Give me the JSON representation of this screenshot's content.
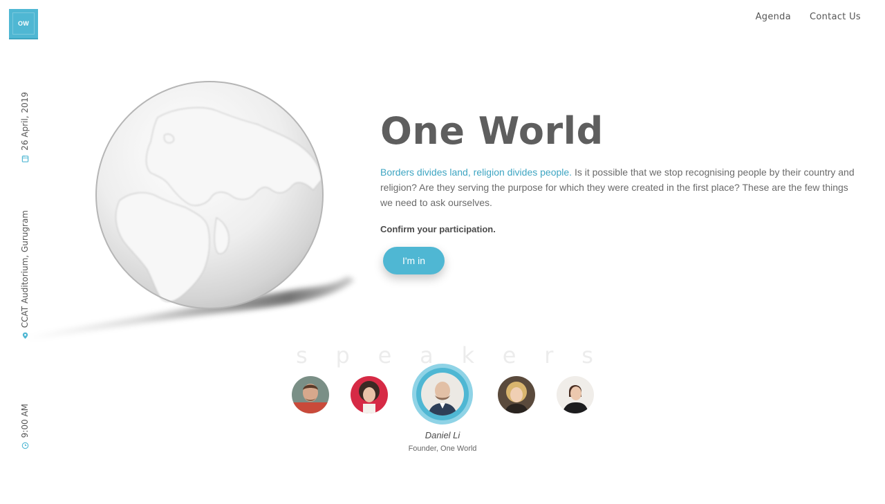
{
  "brand": {
    "logo_text": "OW",
    "accent_color": "#4fb7d3"
  },
  "nav": {
    "items": [
      "Agenda",
      "Contact Us"
    ]
  },
  "event": {
    "date": "26 April, 2019",
    "venue": "CCAT Auditorium, Gurugram",
    "time": "9:00 AM",
    "date_icon": "calendar-icon",
    "venue_icon": "location-pin-icon",
    "time_icon": "clock-icon"
  },
  "hero": {
    "title": "One World",
    "highlight": "Borders divides land, religion divides people.",
    "description": " Is it possible that we stop recognising people by their country and religion? Are they serving the purpose for which they were created in the first place? These are the few things we need to ask ourselves.",
    "confirm_text": "Confirm your participation.",
    "cta_label": "I'm in"
  },
  "speakers": {
    "heading_letters": [
      "s",
      "p",
      "e",
      "a",
      "k",
      "e",
      "r",
      "s"
    ],
    "active": {
      "name": "Daniel Li",
      "role": "Founder, One World"
    },
    "avatars": [
      {
        "label": "speaker-1",
        "bg": "#c94a3a"
      },
      {
        "label": "speaker-2",
        "bg": "#d62a45"
      },
      {
        "label": "speaker-3",
        "bg": "#e8e6e2"
      },
      {
        "label": "speaker-4",
        "bg": "#5a4a3c"
      },
      {
        "label": "speaker-5",
        "bg": "#f0ede9"
      }
    ]
  }
}
